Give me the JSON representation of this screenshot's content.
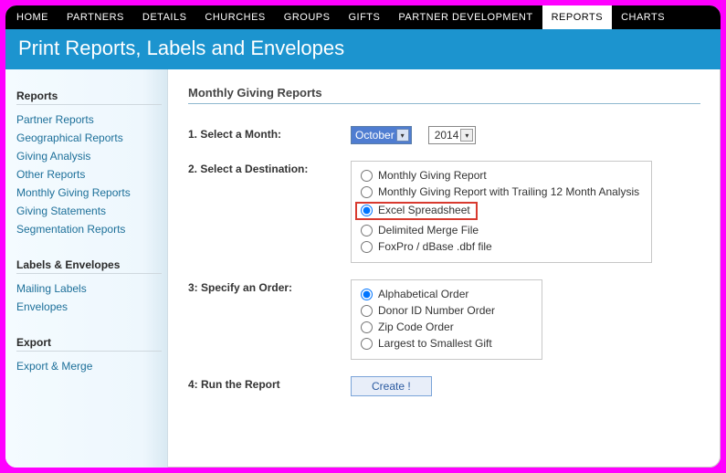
{
  "topnav": {
    "items": [
      "HOME",
      "PARTNERS",
      "DETAILS",
      "CHURCHES",
      "GROUPS",
      "GIFTS",
      "PARTNER DEVELOPMENT",
      "REPORTS",
      "CHARTS"
    ],
    "active_index": 7
  },
  "titlebar": "Print Reports, Labels and Envelopes",
  "sidebar": {
    "group1_title": "Reports",
    "group1_items": [
      "Partner Reports",
      "Geographical Reports",
      "Giving Analysis",
      "Other Reports",
      "Monthly Giving Reports",
      "Giving Statements",
      "Segmentation Reports"
    ],
    "group2_title": "Labels & Envelopes",
    "group2_items": [
      "Mailing Labels",
      "Envelopes"
    ],
    "group3_title": "Export",
    "group3_items": [
      "Export & Merge"
    ]
  },
  "main": {
    "section_title": "Monthly Giving Reports",
    "step1_label": "1.  Select a Month:",
    "month_value": "October",
    "year_value": "2014",
    "step2_label": "2. Select a Destination:",
    "dest_options": [
      "Monthly Giving Report",
      "Monthly Giving Report with Trailing 12 Month Analysis",
      "Excel Spreadsheet",
      "Delimited Merge File",
      "FoxPro / dBase .dbf file"
    ],
    "dest_selected_index": 2,
    "step3_label": "3: Specify an Order:",
    "order_options": [
      "Alphabetical Order",
      "Donor ID Number Order",
      "Zip Code Order",
      "Largest to Smallest Gift"
    ],
    "order_selected_index": 0,
    "step4_label": "4: Run the Report",
    "create_button": "Create !"
  }
}
